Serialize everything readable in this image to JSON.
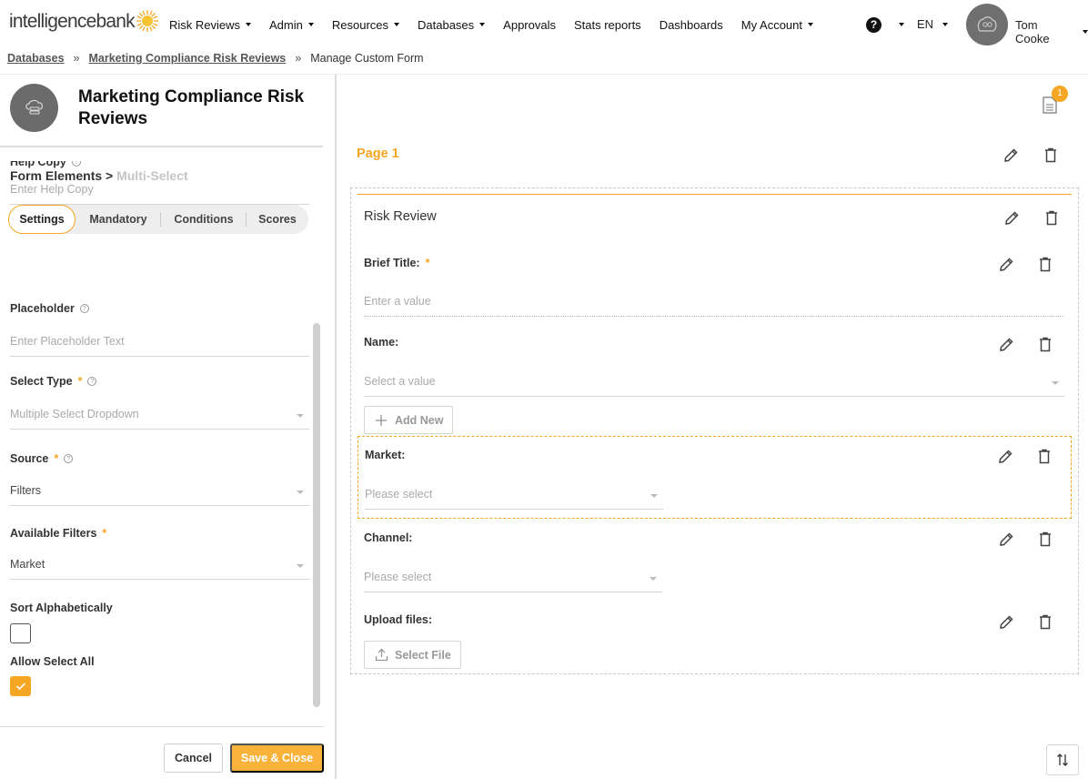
{
  "brand": {
    "logo_text": "intelligencebank",
    "accent_color": "#f5a623"
  },
  "nav": {
    "items": [
      {
        "label": "Risk Reviews",
        "has_dropdown": true
      },
      {
        "label": "Admin",
        "has_dropdown": true
      },
      {
        "label": "Resources",
        "has_dropdown": true
      },
      {
        "label": "Databases",
        "has_dropdown": true
      },
      {
        "label": "Approvals",
        "has_dropdown": false
      },
      {
        "label": "Stats reports",
        "has_dropdown": false
      },
      {
        "label": "Dashboards",
        "has_dropdown": false
      },
      {
        "label": "My Account",
        "has_dropdown": true
      }
    ],
    "help_glyph": "?",
    "language": "EN",
    "user_name": "Tom Cooke"
  },
  "breadcrumb": {
    "items": [
      "Databases",
      "Marketing Compliance Risk Reviews",
      "Manage Custom Form"
    ],
    "separator": "»"
  },
  "left": {
    "project_title": "Marketing Compliance Risk Reviews",
    "form_elements_label": "Form Elements >",
    "current_element": "Multi-Select",
    "tabs": [
      "Settings",
      "Mandatory",
      "Conditions",
      "Scores"
    ],
    "active_tab": "Settings",
    "fields": {
      "help_copy": {
        "label": "Help Copy",
        "placeholder": "Enter Help Copy"
      },
      "placeholder": {
        "label": "Placeholder",
        "placeholder": "Enter Placeholder Text"
      },
      "select_type": {
        "label": "Select Type",
        "value": "Multiple Select Dropdown"
      },
      "source": {
        "label": "Source",
        "value": "Filters"
      },
      "available_filters": {
        "label": "Available Filters",
        "value": "Market"
      },
      "sort_alphabetically": {
        "label": "Sort Alphabetically",
        "checked": false
      },
      "allow_select_all": {
        "label": "Allow Select All",
        "checked": true
      }
    },
    "required_marker": "*",
    "help_marker": "?",
    "cancel_label": "Cancel",
    "save_label": "Save & Close"
  },
  "right": {
    "notification_count": "1",
    "page_title": "Page 1",
    "section_title": "Risk Review",
    "fields": {
      "brief_title": {
        "label": "Brief Title:",
        "required": true,
        "placeholder": "Enter a value"
      },
      "name": {
        "label": "Name:",
        "placeholder": "Select a value",
        "add_new_label": "Add New"
      },
      "market": {
        "label": "Market:",
        "placeholder": "Please select"
      },
      "channel": {
        "label": "Channel:",
        "placeholder": "Please select"
      },
      "upload": {
        "label": "Upload files:",
        "button_label": "Select File"
      }
    }
  }
}
